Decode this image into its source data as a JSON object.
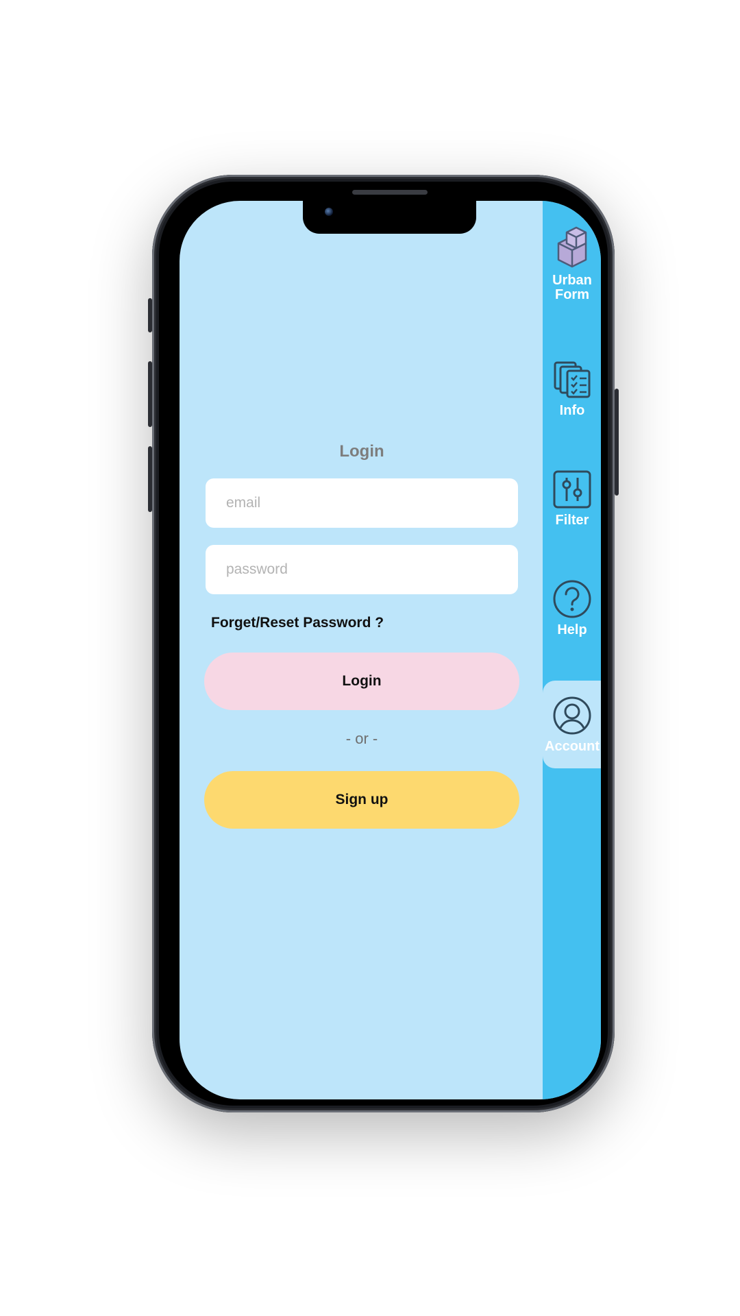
{
  "login": {
    "title": "Login",
    "email_placeholder": "email",
    "password_placeholder": "password",
    "forgot_label": "Forget/Reset Password ?",
    "login_label": "Login",
    "or_label": "- or -",
    "signup_label": "Sign up"
  },
  "nav": {
    "brand_line1": "Urban",
    "brand_line2": "Form",
    "items": [
      {
        "label": "Info",
        "icon": "document-stack-icon"
      },
      {
        "label": "Filter",
        "icon": "filter-sliders-icon"
      },
      {
        "label": "Help",
        "icon": "help-question-icon"
      },
      {
        "label": "Account",
        "icon": "account-user-icon",
        "active": true
      }
    ]
  },
  "colors": {
    "screen_bg": "#bde5fa",
    "rail_bg": "#44c0f0",
    "login_button": "#f7d7e4",
    "signup_button": "#fdd96f",
    "icon_stroke": "#2f4a5c"
  }
}
